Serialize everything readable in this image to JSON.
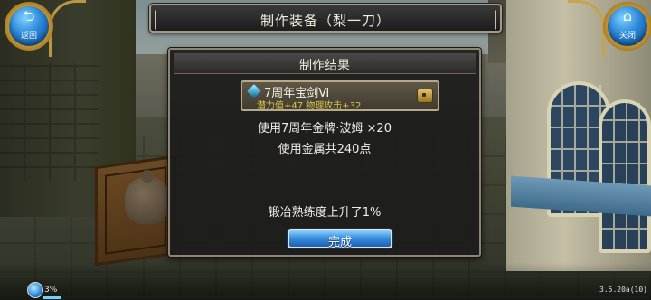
{
  "title_bar": {
    "title": "制作装备（梨一刀）"
  },
  "corner_buttons": {
    "back_label": "返回",
    "close_label": "关闭"
  },
  "dialog": {
    "title": "制作结果",
    "item": {
      "name": "7周年宝剑Ⅵ",
      "stats": "潜力值+47  物理攻击+32"
    },
    "material_line": "使用7周年金牌·波姆  ×20",
    "metal_line": "使用金属共240点",
    "proficiency_line": "锻冶熟练度上升了1%",
    "confirm_label": "完成"
  },
  "status": {
    "percent_text": "3%",
    "progress_fraction": 0.03,
    "version": "3.5.20a(10)"
  },
  "colors": {
    "item_stats": "#d9c44a",
    "confirm_button": "#3a90e0",
    "orb_blue": "#2a86d8"
  }
}
